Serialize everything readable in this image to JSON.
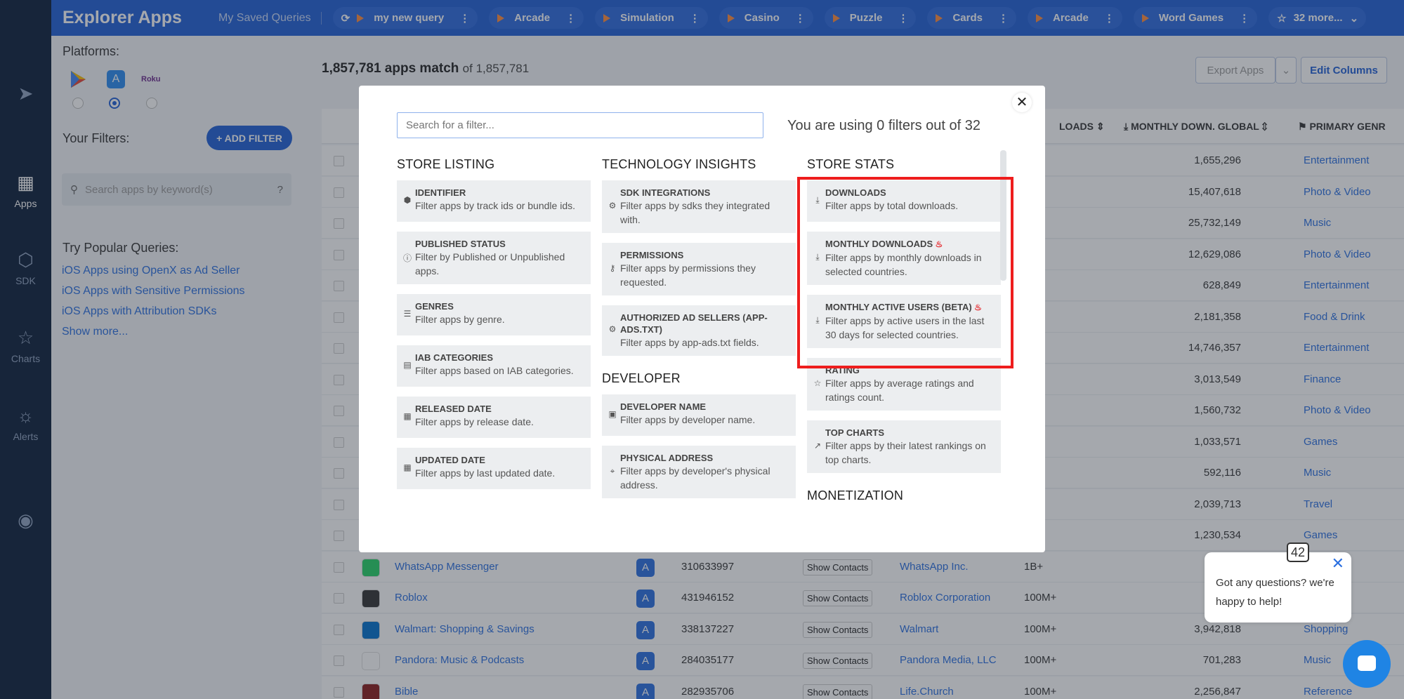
{
  "app": {
    "brand": "Explorer Apps",
    "saved_queries": "My Saved Queries"
  },
  "query_tabs": [
    "my new query",
    "Arcade",
    "Simulation",
    "Casino",
    "Puzzle",
    "Cards",
    "Arcade",
    "Word Games",
    "32 more..."
  ],
  "nav": [
    {
      "label": "",
      "icon": "rocket-icon"
    },
    {
      "label": "Apps",
      "icon": "apps-grid-icon"
    },
    {
      "label": "SDK",
      "icon": "sdk-icon"
    },
    {
      "label": "Charts",
      "icon": "trophy-icon"
    },
    {
      "label": "Alerts",
      "icon": "alert-icon"
    },
    {
      "label": "",
      "icon": "eye-icon"
    }
  ],
  "side": {
    "platforms_label": "Platforms:",
    "roku": "Roku",
    "filters_label": "Your Filters:",
    "add_filter": "+ ADD FILTER",
    "keyword_placeholder": "Search apps by keyword(s)",
    "popular_label": "Try Popular Queries:",
    "popular": [
      "iOS Apps using OpenX as Ad Seller",
      "iOS Apps with Sensitive Permissions",
      "iOS Apps with Attribution SDKs",
      "Show more..."
    ]
  },
  "main": {
    "count": "1,857,781 apps match",
    "count_of": "of 1,857,781",
    "export": "Export Apps",
    "edit_columns": "Edit Columns",
    "headers": [
      "LOADS",
      "MONTHLY DOWN. GLOBAL",
      "PRIMARY GENR"
    ],
    "rows": [
      {
        "value": "1,655,296",
        "genre": "Entertainment"
      },
      {
        "value": "15,407,618",
        "genre": "Photo & Video"
      },
      {
        "value": "25,732,149",
        "genre": "Music"
      },
      {
        "value": "12,629,086",
        "genre": "Photo & Video"
      },
      {
        "value": "628,849",
        "genre": "Entertainment"
      },
      {
        "value": "2,181,358",
        "genre": "Food & Drink"
      },
      {
        "value": "14,746,357",
        "genre": "Entertainment"
      },
      {
        "value": "3,013,549",
        "genre": "Finance"
      },
      {
        "value": "1,560,732",
        "genre": "Photo & Video"
      },
      {
        "value": "1,033,571",
        "genre": "Games"
      },
      {
        "value": "592,116",
        "genre": "Music"
      },
      {
        "value": "2,039,713",
        "genre": "Travel"
      },
      {
        "value": "1,230,534",
        "genre": "Games"
      },
      {
        "name": "WhatsApp Messenger",
        "id": "310633997",
        "contacts": "Show Contacts",
        "dev": "WhatsApp Inc.",
        "installs": "1B+",
        "value": "",
        "genre": "",
        "color": "#25d366"
      },
      {
        "name": "Roblox",
        "id": "431946152",
        "contacts": "Show Contacts",
        "dev": "Roblox Corporation",
        "installs": "100M+",
        "value": "",
        "genre": "",
        "color": "#333333"
      },
      {
        "name": "Walmart: Shopping & Savings",
        "id": "338137227",
        "contacts": "Show Contacts",
        "dev": "Walmart",
        "installs": "100M+",
        "value": "3,942,818",
        "genre": "Shopping",
        "color": "#0071ce"
      },
      {
        "name": "Pandora: Music & Podcasts",
        "id": "284035177",
        "contacts": "Show Contacts",
        "dev": "Pandora Media, LLC",
        "installs": "100M+",
        "value": "701,283",
        "genre": "Music",
        "color": "#ffffff"
      },
      {
        "name": "Bible",
        "id": "282935706",
        "contacts": "Show Contacts",
        "dev": "Life.Church",
        "installs": "100M+",
        "value": "2,256,847",
        "genre": "Reference",
        "color": "#8b1a1a"
      }
    ]
  },
  "modal": {
    "search_placeholder": "Search for a filter...",
    "usage": "You are using 0 filters out of 32",
    "columns": [
      {
        "title": "STORE LISTING",
        "cards": [
          {
            "title": "IDENTIFIER",
            "desc": "Filter apps by track ids or bundle ids.",
            "icon": "cube-icon"
          },
          {
            "title": "PUBLISHED STATUS",
            "desc": "Filter by Published or Unpublished apps.",
            "icon": "info-icon"
          },
          {
            "title": "GENRES",
            "desc": "Filter apps by genre.",
            "icon": "list-icon"
          },
          {
            "title": "IAB CATEGORIES",
            "desc": "Filter apps based on IAB categories.",
            "icon": "card-icon"
          },
          {
            "title": "RELEASED DATE",
            "desc": "Filter apps by release date.",
            "icon": "calendar-icon"
          },
          {
            "title": "UPDATED DATE",
            "desc": "Filter apps by last updated date.",
            "icon": "calendar-icon"
          }
        ]
      },
      {
        "title": "TECHNOLOGY INSIGHTS",
        "cards": [
          {
            "title": "SDK INTEGRATIONS",
            "desc": "Filter apps by sdks they integrated with.",
            "icon": "gear-icon"
          },
          {
            "title": "PERMISSIONS",
            "desc": "Filter apps by permissions they requested.",
            "icon": "key-icon"
          },
          {
            "title": "AUTHORIZED AD SELLERS (APP-ADS.TXT)",
            "desc": "Filter apps by app-ads.txt fields.",
            "icon": "gear-icon"
          }
        ],
        "title2": "DEVELOPER",
        "cards2": [
          {
            "title": "DEVELOPER NAME",
            "desc": "Filter apps by developer name.",
            "icon": "id-card-icon"
          },
          {
            "title": "PHYSICAL ADDRESS",
            "desc": "Filter apps by developer's physical address.",
            "icon": "map-pin-icon"
          }
        ]
      },
      {
        "title": "STORE STATS",
        "cards": [
          {
            "title": "DOWNLOADS",
            "desc": "Filter apps by total downloads.",
            "icon": "download-icon"
          },
          {
            "title": "MONTHLY DOWNLOADS",
            "desc": "Filter apps by monthly downloads in selected countries.",
            "icon": "download-icon",
            "hot": true
          },
          {
            "title": "MONTHLY ACTIVE USERS (BETA)",
            "desc": "Filter apps by active users in the last 30 days for selected countries.",
            "icon": "download-icon",
            "hot": true
          },
          {
            "title": "RATING",
            "desc": "Filter apps by average ratings and ratings count.",
            "icon": "star-icon"
          },
          {
            "title": "TOP CHARTS",
            "desc": "Filter apps by their latest rankings on top charts.",
            "icon": "chart-line-icon"
          }
        ],
        "title2": "MONETIZATION"
      }
    ]
  },
  "chat": {
    "badge": "42",
    "text": "Got any questions? we're happy to help!"
  }
}
